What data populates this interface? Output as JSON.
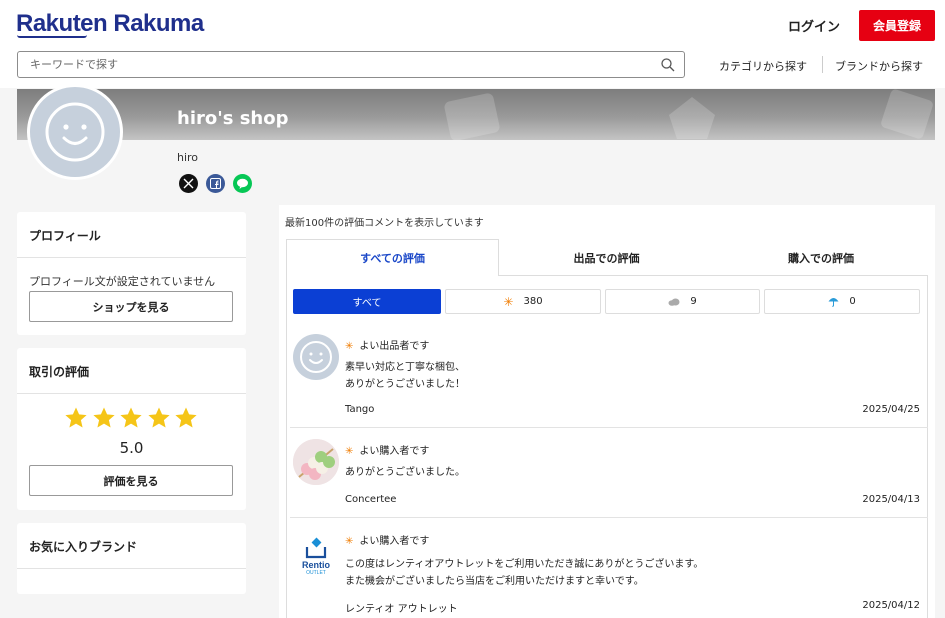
{
  "header": {
    "logo": "Rakuten Rakuma",
    "login": "ログイン",
    "register": "会員登録",
    "search_placeholder": "キーワードで探す",
    "nav_category": "カテゴリから探す",
    "nav_brand": "ブランドから探す"
  },
  "shop": {
    "name": "hiro's shop",
    "user": "hiro",
    "social": [
      "x-icon",
      "facebook-icon",
      "line-icon"
    ]
  },
  "sidebar": {
    "profile": {
      "title": "プロフィール",
      "text": "プロフィール文が設定されていません",
      "button": "ショップを見る"
    },
    "rating": {
      "title": "取引の評価",
      "stars": 5,
      "score": "5.0",
      "button": "評価を見る"
    },
    "brands": {
      "title": "お気に入りブランド"
    }
  },
  "main": {
    "notice": "最新100件の評価コメントを表示しています",
    "tabs": [
      {
        "label": "すべての評価",
        "active": true
      },
      {
        "label": "出品での評価",
        "active": false
      },
      {
        "label": "購入での評価",
        "active": false
      }
    ],
    "filters": [
      {
        "label": "すべて",
        "icon": "",
        "active": true
      },
      {
        "label": "380",
        "icon": "sun-icon",
        "active": false
      },
      {
        "label": "9",
        "icon": "cloud-icon",
        "active": false
      },
      {
        "label": "0",
        "icon": "umbrella-icon",
        "active": false
      }
    ],
    "reviews": [
      {
        "type": "よい出品者です",
        "lines": [
          "素早い対応と丁寧な梱包、",
          "ありがとうございました！"
        ],
        "name": "Tango",
        "date": "2025/04/25"
      },
      {
        "type": "よい購入者です",
        "lines": [
          "ありがとうございました。"
        ],
        "name": "Concertee",
        "date": "2025/04/13"
      },
      {
        "type": "よい購入者です",
        "lines": [
          "この度はレンティオアウトレットをご利用いただき誠にありがとうございます。",
          "また機会がございましたら当店をご利用いただけますと幸いです。"
        ],
        "name": "レンティオ アウトレット",
        "date": "2025/04/12",
        "avatar_text": "Rentio",
        "avatar_subtext": "OUTLET"
      }
    ]
  },
  "colors": {
    "brand": "#1f2f8c",
    "register": "#e60012",
    "accent": "#0b3fd4",
    "star": "#f5c518",
    "sun": "#f07c00"
  }
}
